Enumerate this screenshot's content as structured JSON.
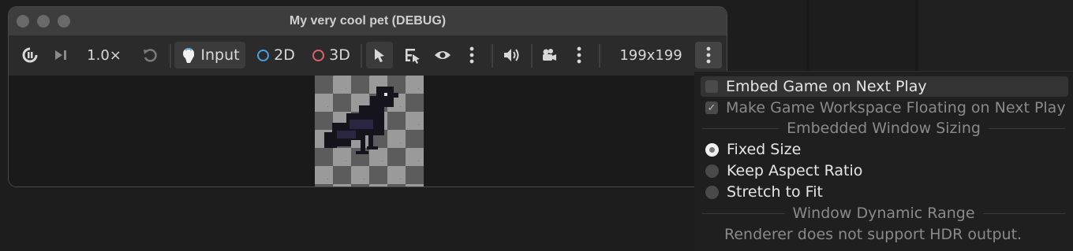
{
  "window": {
    "title": "My very cool pet (DEBUG)"
  },
  "toolbar": {
    "speed": "1.0×",
    "input_label": "Input",
    "mode_2d": "2D",
    "mode_3d": "3D",
    "resolution": "199x199"
  },
  "icons": {
    "pause": "pause-icon",
    "step": "step-icon",
    "reset_speed": "reset-icon",
    "input": "input-icon",
    "select": "select-arrow-icon",
    "list_select": "list-select-icon",
    "eye": "eye-icon",
    "speaker": "speaker-icon",
    "camera": "camera-icon",
    "more": "more-vertical-icon"
  },
  "colors": {
    "ring_2d": "#4aa0e6",
    "ring_3d": "#e0606a"
  },
  "menu": {
    "embed_game": "Embed Game on Next Play",
    "make_floating": "Make Game Workspace Floating on Next Play",
    "sizing_header": "Embedded Window Sizing",
    "fixed_size": "Fixed Size",
    "keep_aspect": "Keep Aspect Ratio",
    "stretch": "Stretch to Fit",
    "hdr_header": "Window Dynamic Range",
    "hdr_note": "Renderer does not support HDR output.",
    "selected_sizing": "Fixed Size"
  }
}
